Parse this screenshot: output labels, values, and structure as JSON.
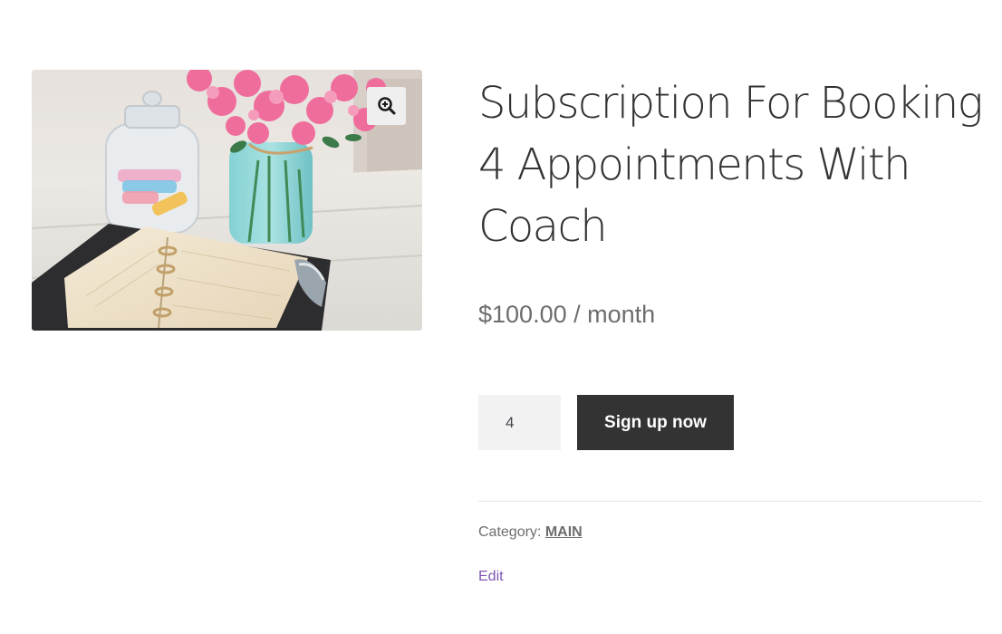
{
  "product": {
    "image_alt": "Planner with flowers in a glass vase",
    "zoom_icon": "zoom-in-icon",
    "title": "Subscription For Booking 4 Appointments With Coach",
    "price": "$100.00 / month",
    "quantity": "4",
    "signup_label": "Sign up now",
    "category_label": "Category: ",
    "category_value": "MAIN",
    "edit_label": "Edit"
  },
  "colors": {
    "button_bg": "#333333",
    "button_text": "#ffffff",
    "quantity_bg": "#f2f2f2",
    "price_text": "#6d6d6d",
    "edit_link": "#7f54b3"
  }
}
